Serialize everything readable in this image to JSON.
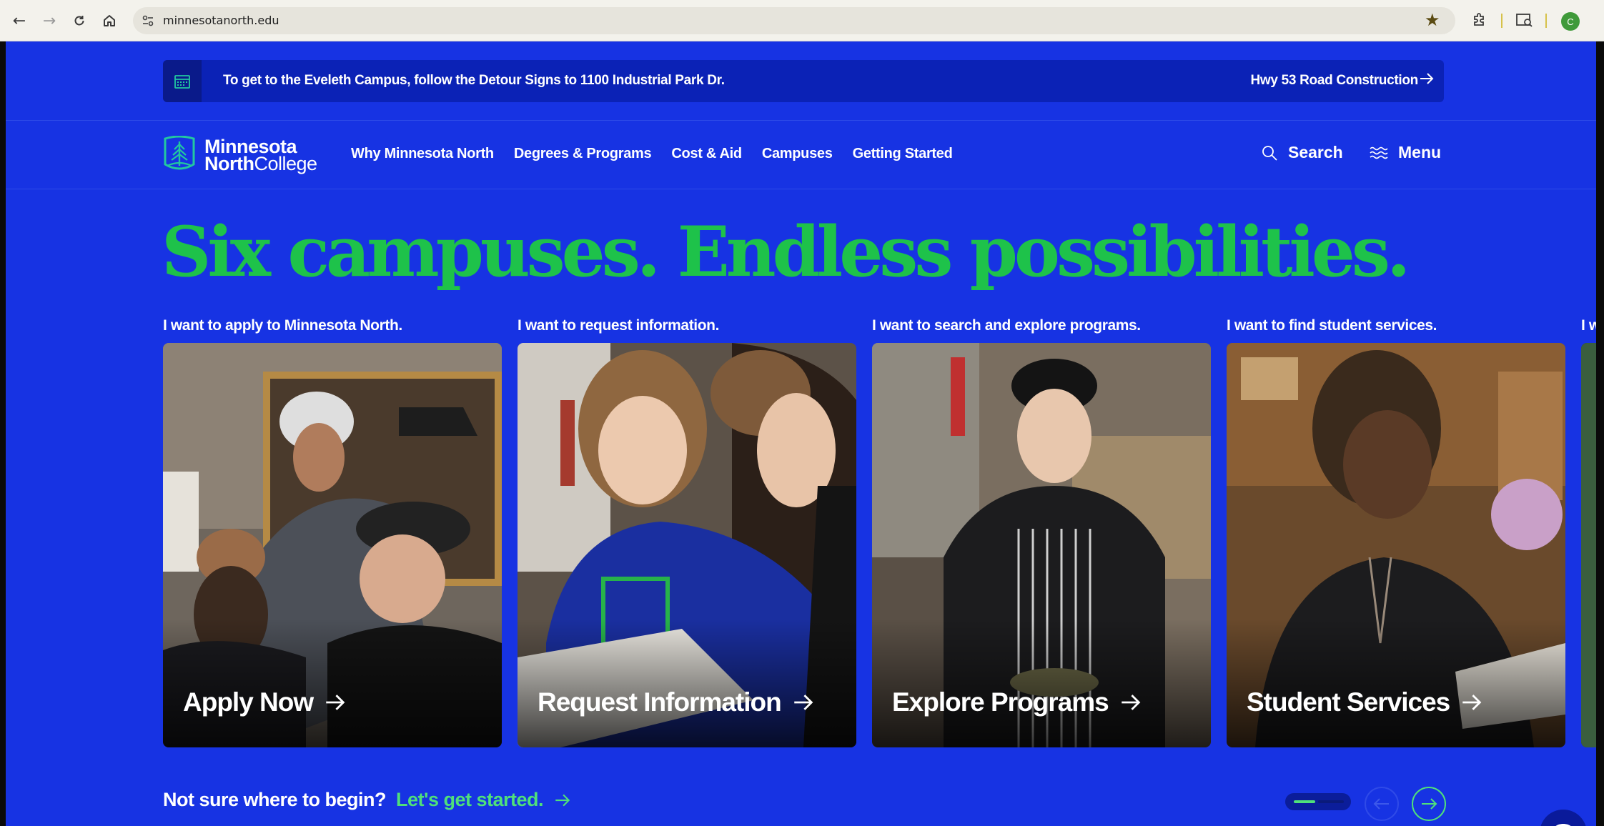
{
  "browser": {
    "url": "minnesotanorth.edu",
    "profile_initial": "C"
  },
  "alert": {
    "message": "To get to the Eveleth Campus, follow the Detour Signs to 1100 Industrial Park Dr.",
    "link_label": "Hwy 53 Road Construction"
  },
  "logo": {
    "line1": "Minnesota",
    "line2_bold": "North",
    "line2_rest": "College"
  },
  "nav": {
    "links": [
      "Why Minnesota North",
      "Degrees & Programs",
      "Cost & Aid",
      "Campuses",
      "Getting Started"
    ],
    "search_label": "Search",
    "menu_label": "Menu"
  },
  "hero": {
    "headline": "Six campuses. Endless possibilities."
  },
  "cards": [
    {
      "caption": "I want to apply to Minnesota North.",
      "cta": "Apply Now"
    },
    {
      "caption": "I want to request information.",
      "cta": "Request Information"
    },
    {
      "caption": "I want to search and explore programs.",
      "cta": "Explore Programs"
    },
    {
      "caption": "I want to find student services.",
      "cta": "Student Services"
    },
    {
      "caption": "I w",
      "cta": ""
    }
  ],
  "footer": {
    "question": "Not sure where to begin?",
    "link": "Let's get started."
  },
  "colors": {
    "page_bg": "#1733e3",
    "alert_bg": "#0b22b6",
    "headline_green": "#1ec24a",
    "link_green": "#4fe07a"
  },
  "slider": {
    "position": 1,
    "total": 3
  }
}
